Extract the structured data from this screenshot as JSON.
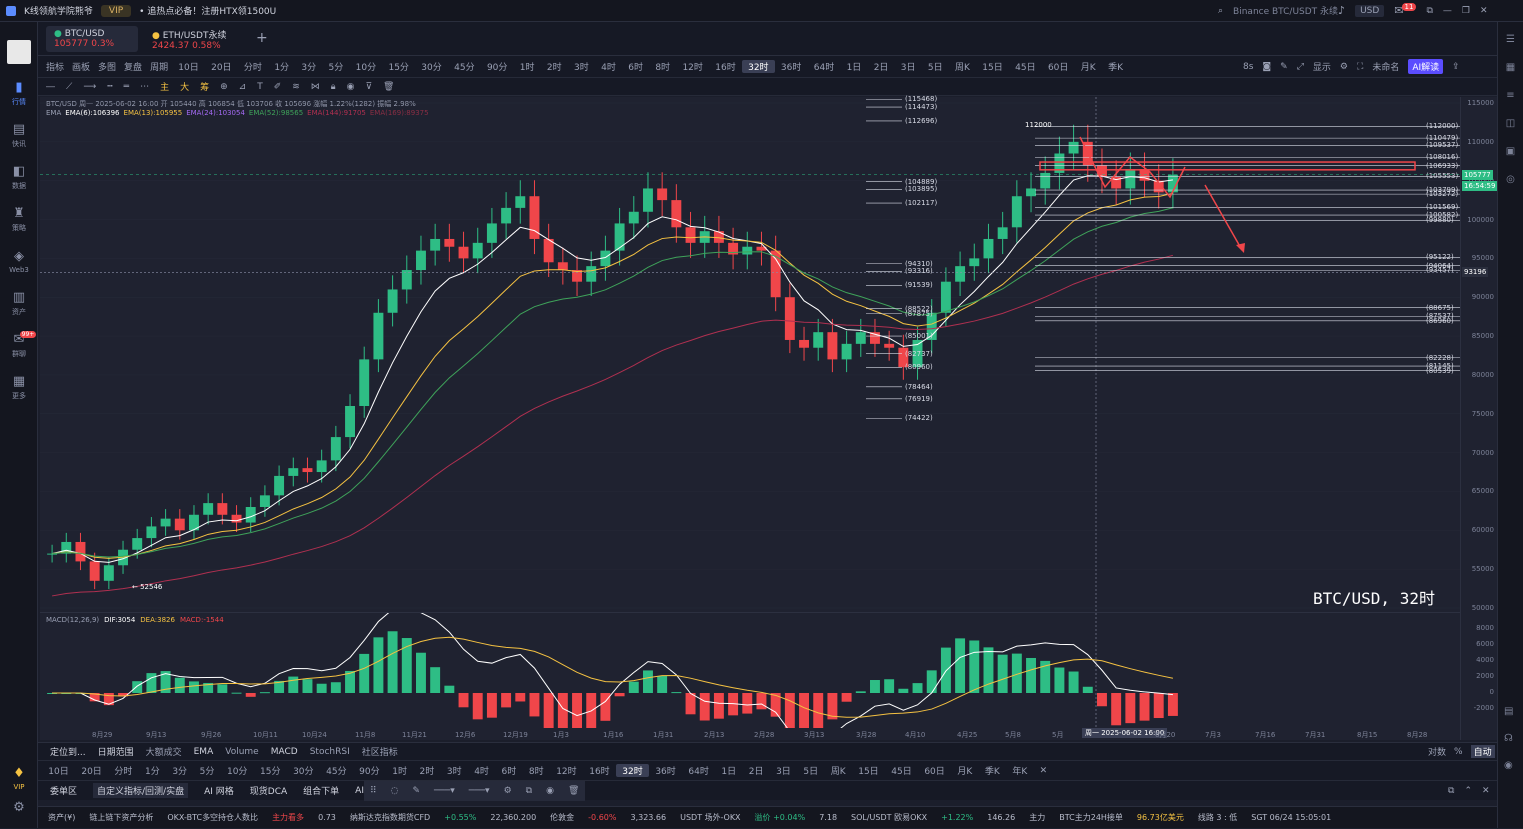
{
  "titlebar": {
    "app": "K线领航学院熊爷",
    "vip": "VIP",
    "promo": "• 追热点必备！注册HTX领1500U",
    "search": "Binance BTC/USDT 永续",
    "currency": "USD",
    "badge": "11"
  },
  "leftnav": [
    {
      "icon": "chart-icon",
      "label": "行情"
    },
    {
      "icon": "news-icon",
      "label": "快讯"
    },
    {
      "icon": "data-icon",
      "label": "数据"
    },
    {
      "icon": "strategy-icon",
      "label": "策略"
    },
    {
      "icon": "web3-icon",
      "label": "Web3"
    },
    {
      "icon": "assets-icon",
      "label": "资产"
    },
    {
      "icon": "community-icon",
      "label": "群聊",
      "badge": "99+"
    },
    {
      "icon": "more-icon",
      "label": "更多"
    }
  ],
  "leftnav_bottom": [
    {
      "label": "VIP"
    }
  ],
  "tabs": [
    {
      "name": "BTC/USD",
      "price": "105777",
      "change": "0.3%",
      "active": true
    },
    {
      "name": "ETH/USDT永续",
      "price": "2424.37",
      "change": "0.58%",
      "active": false
    }
  ],
  "toolbar1": [
    "指标",
    "画板",
    "多图",
    "复盘",
    "周期",
    "10日",
    "20日",
    "分时",
    "1分",
    "3分",
    "5分",
    "10分",
    "15分",
    "30分",
    "45分",
    "90分",
    "1时",
    "2时",
    "3时",
    "4时",
    "6时",
    "8时",
    "12时",
    "16时",
    "32时",
    "36时",
    "64时",
    "1日",
    "2日",
    "3日",
    "5日",
    "周K",
    "15日",
    "45日",
    "60日",
    "月K",
    "季K"
  ],
  "toolbar1_active": "32时",
  "toolbar1_right": {
    "interval": "8s",
    "display": "显示",
    "unnamed": "未命名",
    "ai": "AI解读"
  },
  "toolbar2": [
    "主",
    "大",
    "筹"
  ],
  "legend": {
    "line1": "BTC/USD 周一 2025-06-02 16:00 开 105440 高 106854 低 103706 收 105696 涨幅 1.22%(1282) 振幅 2.98%",
    "ema_label": "EMA",
    "ema6": "EMA(6):106396",
    "ema13": "EMA(13):105955",
    "ema24": "EMA(24):103054",
    "ema52": "EMA(52):98565",
    "ema144": "EMA(144):91705",
    "ema169": "EMA(169):89375"
  },
  "chart_data": {
    "type": "candlestick",
    "symbol": "BTC/USD",
    "timeframe": "32时",
    "watermark": "BTC/USD, 32时",
    "y_ticks": [
      115000,
      110000,
      105000,
      100000,
      95000,
      90000,
      85000,
      80000,
      75000,
      70000,
      65000,
      60000,
      55000,
      50000
    ],
    "last_price": "105777",
    "countdown": "16:54:59",
    "crosshair_price": "93196",
    "fib_left": [
      "(115468)",
      "(114473)",
      "(112696)",
      "(104889)",
      "(103895)",
      "(102117)",
      "(94310)",
      "(93316)",
      "(91539)",
      "(88522)",
      "(87875)",
      "(85001)",
      "(82737)",
      "(80960)",
      "(78464)",
      "(76919)",
      "(74422)"
    ],
    "fib_right": [
      "(112000)",
      "(110479)",
      "(109537)",
      "(108016)",
      "(106933)",
      "(105553)",
      "(103799)",
      "(103272)",
      "(101569)",
      "(100582)",
      "(99880)",
      "(95122)",
      "(94064)",
      "(93457)",
      "(88675)",
      "(87537)",
      "(86960)",
      "(82228)",
      "(81145)",
      "(80539)"
    ],
    "low_label": "52546",
    "high_label": "112000",
    "x_ticks": [
      "8月29",
      "9月13",
      "9月26",
      "10月11",
      "10月24",
      "11月8",
      "11月21",
      "12月6",
      "12月19",
      "1月3",
      "1月16",
      "1月31",
      "2月13",
      "2月28",
      "3月13",
      "3月28",
      "4月10",
      "4月25",
      "5月8",
      "5月",
      "周一 2025-06-02 16:00",
      "6月20",
      "7月3",
      "7月16",
      "7月31",
      "8月15",
      "8月28"
    ],
    "close": [
      57000,
      58500,
      56000,
      53500,
      55500,
      57500,
      59000,
      60500,
      61500,
      60000,
      62000,
      63500,
      62000,
      61000,
      63000,
      64500,
      67000,
      68000,
      67500,
      69000,
      72000,
      76000,
      82000,
      88000,
      91000,
      93500,
      96000,
      97500,
      96500,
      95000,
      97000,
      99500,
      101500,
      103000,
      97500,
      94500,
      93500,
      92000,
      94000,
      96000,
      99500,
      101000,
      104000,
      102500,
      99000,
      97000,
      98500,
      97000,
      95500,
      96500,
      96000,
      90000,
      84500,
      83500,
      85500,
      82000,
      84000,
      85500,
      84000,
      83500,
      81000,
      84500,
      88000,
      92000,
      94000,
      95000,
      97500,
      99000,
      103000,
      104000,
      106000,
      108500,
      110000,
      107000,
      105500,
      104000,
      106500,
      105000,
      103500,
      105777
    ],
    "macd": {
      "dif": "3054",
      "dea": "3826",
      "macd": "-1544",
      "y_ticks": [
        8000,
        6000,
        4000,
        2000,
        0,
        -2000
      ]
    }
  },
  "bottom1": {
    "locate": "定位到...",
    "range": "日期范围",
    "indicators": [
      "大额成交",
      "EMA",
      "Volume",
      "MACD",
      "StochRSI"
    ],
    "community": "社区指标",
    "right": [
      "对数",
      "%",
      "自动"
    ]
  },
  "bottom2": [
    "10日",
    "20日",
    "分时",
    "1分",
    "3分",
    "5分",
    "10分",
    "15分",
    "30分",
    "45分",
    "90分",
    "1时",
    "2时",
    "3时",
    "4时",
    "6时",
    "8时",
    "12时",
    "16时",
    "32时",
    "36时",
    "64时",
    "1日",
    "2日",
    "3日",
    "5日",
    "周K",
    "15日",
    "45日",
    "60日",
    "月K",
    "季K",
    "年K"
  ],
  "bottom2_active": "32时",
  "bottom3": [
    "委单区",
    "自定义指标/回测/实盘",
    "AI 网格",
    "现货DCA",
    "组合下单",
    "AI"
  ],
  "status": [
    {
      "t": "资产(¥)"
    },
    {
      "t": "链上链下资产分析"
    },
    {
      "t": "OKX-BTC多空持仓人数比"
    },
    {
      "t": "主力看多",
      "c": "#f0464a"
    },
    {
      "t": "0.73"
    },
    {
      "t": "纳斯达克指数期货CFD"
    },
    {
      "t": "+0.55%",
      "c": "#2ebd85"
    },
    {
      "t": "22,360.200"
    },
    {
      "t": "伦敦金"
    },
    {
      "t": "-0.60%",
      "c": "#f0464a"
    },
    {
      "t": "3,323.66"
    },
    {
      "t": "USDT 场外-OKX"
    },
    {
      "t": "溢价 +0.04%",
      "c": "#2ebd85"
    },
    {
      "t": "7.18"
    },
    {
      "t": "SOL/USDT 欧易OKX"
    },
    {
      "t": "+1.22%",
      "c": "#2ebd85"
    },
    {
      "t": "146.26"
    },
    {
      "t": "主力"
    },
    {
      "t": "BTC主力24H接单"
    },
    {
      "t": "96.73亿美元",
      "c": "#f5c242"
    },
    {
      "t": "线路 3 : 低"
    },
    {
      "t": "SGT 06/24 15:05:01"
    }
  ]
}
